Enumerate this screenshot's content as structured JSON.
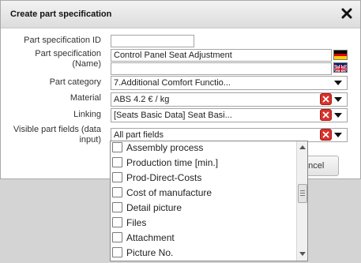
{
  "dialog": {
    "title": "Create part specification",
    "close_icon": "close-x-icon"
  },
  "form": {
    "id_label": "Part specification ID",
    "id_value": "",
    "name_label_line1": "Part specification",
    "name_label_line2": "(Name)",
    "name_value_de": "Control Panel Seat Adjustment",
    "name_value_en": "",
    "category_label": "Part category",
    "category_value": "7.Additional Comfort Functio...",
    "material_label": "Material",
    "material_value": "ABS 4.2 € / kg",
    "linking_label": "Linking",
    "linking_value": "[Seats Basic Data] Seat Basi...",
    "visible_label_line1": "Visible part fields (data",
    "visible_label_line2": "input)",
    "visible_value": "All part fields"
  },
  "buttons": {
    "cancel_label_partial": "ancel"
  },
  "dropdown": {
    "items": [
      "Assembly process",
      "Production time [min.]",
      "Prod-Direct-Costs",
      "Cost of manufacture",
      "Detail picture",
      "Files",
      "Attachment",
      "Picture No."
    ]
  },
  "colors": {
    "clear_button": "#d9322b",
    "dialog_bg": "#ffffff",
    "page_bg": "#d4d4d4"
  }
}
